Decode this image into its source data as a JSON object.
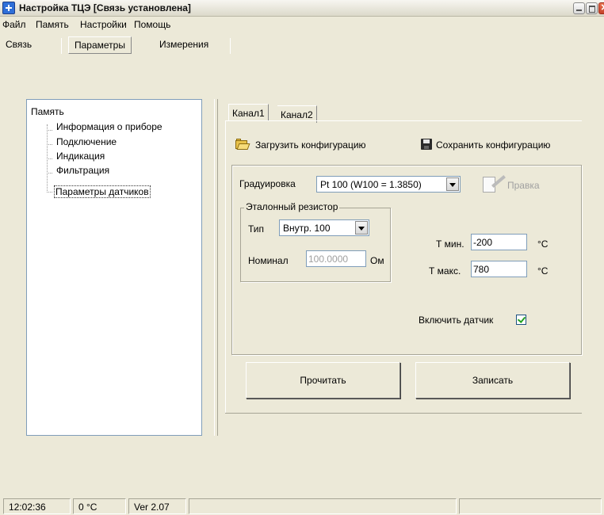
{
  "window": {
    "title": "Настройка ТЦЭ [Связь установлена]"
  },
  "menu": [
    "Файл",
    "Память",
    "Настройки",
    "Помощь"
  ],
  "top_tabs": [
    {
      "label": "Связь",
      "active": false
    },
    {
      "label": "Параметры",
      "active": true
    },
    {
      "label": "Измерения",
      "active": false
    }
  ],
  "tree": {
    "root": "Память",
    "children": [
      {
        "label": "Информация о приборе",
        "selected": false
      },
      {
        "label": "Подключение",
        "selected": false
      },
      {
        "label": "Индикация",
        "selected": false
      },
      {
        "label": "Фильтрация",
        "selected": false
      },
      {
        "label": "Параметры датчиков",
        "selected": true
      }
    ]
  },
  "channel_tabs": [
    {
      "label": "Канал1",
      "active": true
    },
    {
      "label": "Канал2",
      "active": false
    }
  ],
  "toolbar": {
    "load_label": "Загрузить конфигурацию",
    "save_label": "Сохранить конфигурацию"
  },
  "calibration": {
    "label": "Градуировка",
    "value": "Pt 100 (W100 = 1.3850)",
    "edit_label": "Правка"
  },
  "reference_resistor": {
    "legend": "Эталонный резистор",
    "type_label": "Тип",
    "type_value": "Внутр. 100",
    "nominal_label": "Номинал",
    "nominal_value": "100.0000",
    "nominal_unit": "Ом"
  },
  "temperature": {
    "tmin_label": "Т мин.",
    "tmin_value": "-200",
    "tmin_unit": "°C",
    "tmax_label": "Т макс.",
    "tmax_value": "780",
    "tmax_unit": "°C"
  },
  "sensor": {
    "enable_label": "Включить датчик",
    "enabled": true
  },
  "buttons": {
    "read_label": "Прочитать",
    "write_label": "Записать"
  },
  "status": {
    "time": "12:02:36",
    "temperature": "0 °C",
    "version": "Ver 2.07"
  },
  "colors": {
    "background": "#ece9d8",
    "border_blue": "#7f9db9",
    "disabled_text": "#a0a0a0"
  }
}
